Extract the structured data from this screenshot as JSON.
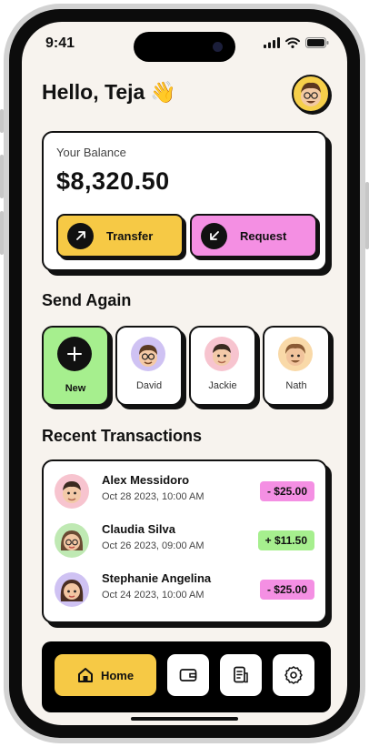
{
  "status_bar": {
    "time": "9:41"
  },
  "header": {
    "greeting": "Hello, Teja",
    "emoji": "👋"
  },
  "balance": {
    "label": "Your Balance",
    "amount": "$8,320.50",
    "transfer_label": "Transfer",
    "request_label": "Request"
  },
  "send_again": {
    "title": "Send Again",
    "new_label": "New",
    "contacts": [
      {
        "name": "David"
      },
      {
        "name": "Jackie"
      },
      {
        "name": "Nath"
      }
    ]
  },
  "transactions": {
    "title": "Recent Transactions",
    "items": [
      {
        "name": "Alex Messidoro",
        "date": "Oct 28 2023, 10:00 AM",
        "amount": "- $25.00",
        "type": "debit"
      },
      {
        "name": "Claudia Silva",
        "date": "Oct 26 2023, 09:00 AM",
        "amount": "+ $11.50",
        "type": "credit"
      },
      {
        "name": "Stephanie Angelina",
        "date": "Oct 24 2023, 10:00 AM",
        "amount": "- $25.00",
        "type": "debit"
      }
    ]
  },
  "tabbar": {
    "home_label": "Home"
  },
  "colors": {
    "yellow": "#f6c945",
    "pink": "#f48fe3",
    "green": "#a6ef8e",
    "background": "#f7f3ee",
    "ink": "#111111"
  },
  "icons": {
    "transfer": "arrow-up-right-icon",
    "request": "arrow-down-left-icon",
    "new": "plus-icon",
    "home": "home-icon",
    "wallet": "wallet-icon",
    "documents": "document-icon",
    "settings": "gear-icon"
  }
}
